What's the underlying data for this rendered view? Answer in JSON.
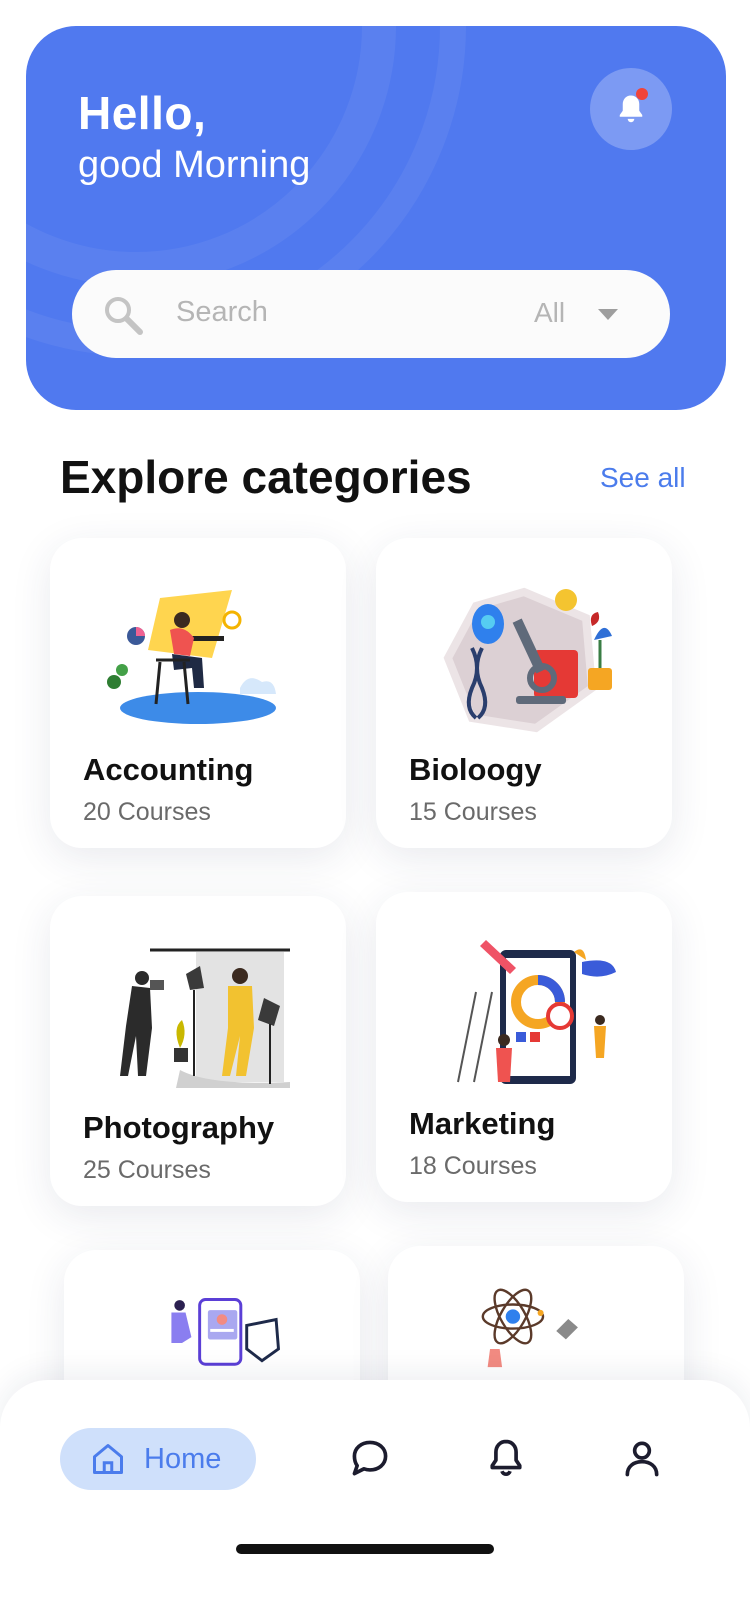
{
  "header": {
    "greeting": "Hello,",
    "subgreeting": "good Morning",
    "background_color": "#5079ef",
    "notification_dot_color": "#f0443a"
  },
  "search": {
    "placeholder": "Search",
    "filter_value": "All"
  },
  "explore": {
    "title": "Explore categories",
    "see_all_label": "See all",
    "categories": [
      {
        "name": "Accounting",
        "count": "20 Courses",
        "icon": "accounting-illustration"
      },
      {
        "name": "Bioloogy",
        "count": "15 Courses",
        "icon": "biology-illustration"
      },
      {
        "name": "Photography",
        "count": "25 Courses",
        "icon": "photography-illustration"
      },
      {
        "name": "Marketing",
        "count": "18 Courses",
        "icon": "marketing-illustration"
      },
      {
        "name": "",
        "count": "",
        "icon": "security-illustration"
      },
      {
        "name": "",
        "count": "",
        "icon": "science-illustration"
      }
    ]
  },
  "bottom_nav": {
    "home_label": "Home",
    "items": [
      "home-icon",
      "chat-icon",
      "bell-icon",
      "profile-icon"
    ],
    "accent_color": "#4b7cec"
  }
}
